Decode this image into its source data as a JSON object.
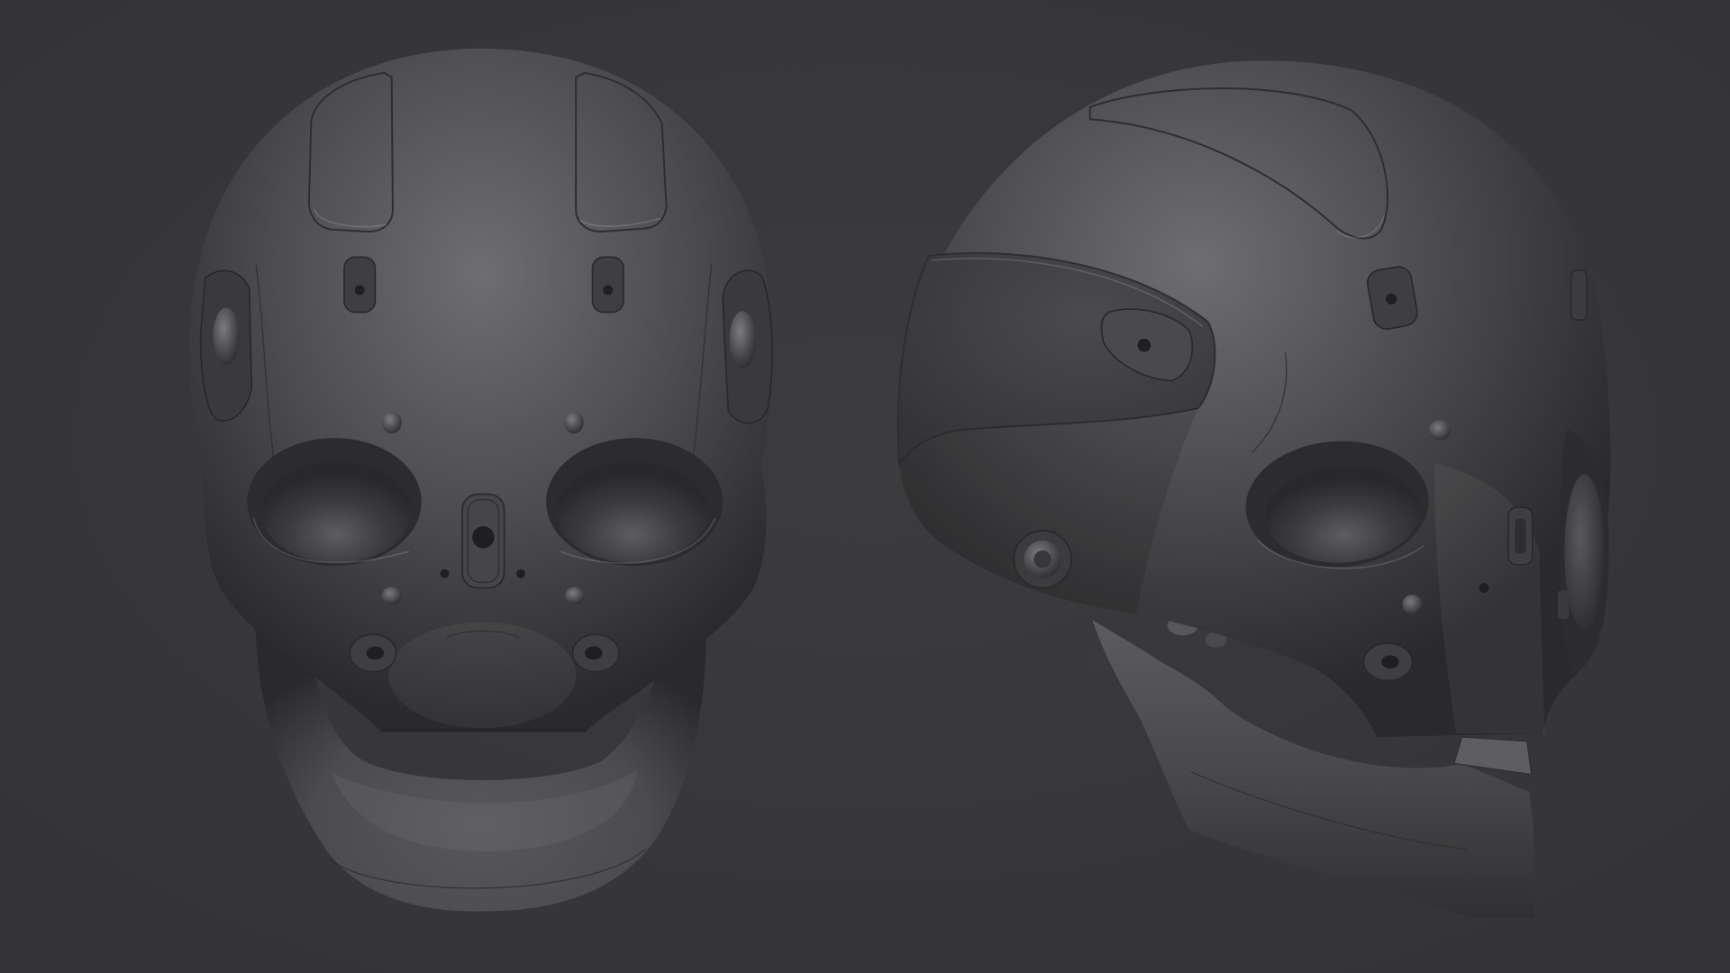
{
  "colors": {
    "background": "#3c3c3f",
    "skull_base": "#4c4c4f",
    "skull_highlight": "#6e6e71",
    "skull_shadow": "#2a2a2c",
    "seam": "#2e2e30"
  }
}
